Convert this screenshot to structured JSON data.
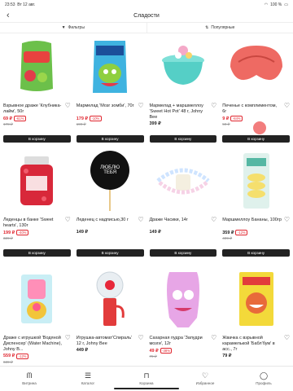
{
  "status": {
    "time": "23:53",
    "date": "Вт 12 авг.",
    "battery": "100 %"
  },
  "header": {
    "title": "Сладости"
  },
  "filters": {
    "filter_label": "Фильтры",
    "sort_label": "Популярные"
  },
  "products": [
    {
      "name": "Взрывное драже 'Клубника-лайм', 50г",
      "price": "69 ₽",
      "discount": "-61%",
      "old": "178 ₽",
      "sale": true
    },
    {
      "name": "Мармелад 'Мозг зомби', 70г",
      "price": "179 ₽",
      "discount": "-10%",
      "old": "199 ₽",
      "sale": true
    },
    {
      "name": "Мармелад + маршмеллоу 'Sweet Hot Pot' 48 г, Johny Bee",
      "price": "399 ₽",
      "discount": "",
      "old": "",
      "sale": false
    },
    {
      "name": "Печенье с комплиментом, 6г",
      "price": "9 ₽",
      "discount": "-84%",
      "old": "59 ₽",
      "sale": true
    },
    {
      "name": "Леденцы в банке 'Sweet hearts', 130г",
      "price": "199 ₽",
      "discount": "-40%",
      "old": "329 ₽",
      "sale": true
    },
    {
      "name": "Леденец с надписью,30 г",
      "price": "149 ₽",
      "discount": "",
      "old": "",
      "sale": false
    },
    {
      "name": "Драже Часики, 14г",
      "price": "149 ₽",
      "discount": "",
      "old": "",
      "sale": false
    },
    {
      "name": "Маршмеллоу Бананы, 100гр",
      "price": "359 ₽",
      "discount": "-12%",
      "old": "409 ₽",
      "sale": false
    },
    {
      "name": "Драже с игрушкой 'Водяной Диспенсер' (Water Machine), Johny B...",
      "price": "559 ₽",
      "discount": "-12%",
      "old": "639 ₽",
      "sale": true
    },
    {
      "name": "Игрушка-автомат'Спираль' 12 г, Johny Bee",
      "price": "449 ₽",
      "discount": "",
      "old": "",
      "sale": false
    },
    {
      "name": "Сахарная пудра 'Запудри мозги', 12г",
      "price": "49 ₽",
      "discount": "-38%",
      "old": "79 ₽",
      "sale": true
    },
    {
      "name": "Жвачка с взрывной карамелькой 'Бабл'бум' в асс., 7г",
      "price": "79 ₽",
      "discount": "",
      "old": "",
      "sale": false
    }
  ],
  "cart_button": "В корзину",
  "lollipop_text": "ЛЮБЛЮ ТЕБЯ",
  "tabs": [
    {
      "label": "Витрина",
      "icon": "logo-icon"
    },
    {
      "label": "Каталог",
      "icon": "catalog-search-icon"
    },
    {
      "label": "Корзина",
      "icon": "bag-icon"
    },
    {
      "label": "Избранное",
      "icon": "heart-icon"
    },
    {
      "label": "Профиль",
      "icon": "profile-icon"
    }
  ]
}
